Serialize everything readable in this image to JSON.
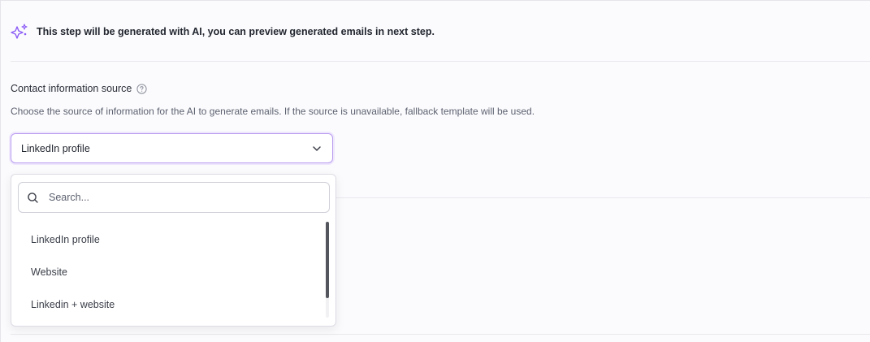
{
  "banner": {
    "icon": "sparkle-icon",
    "text": "This step will be generated with AI, you can preview generated emails in next step."
  },
  "contact_source": {
    "label": "Contact information source",
    "help_icon": "help-circle-icon",
    "description": "Choose the source of information for the AI to generate emails. If the source is unavailable, fallback template will be used.",
    "selected": "LinkedIn profile",
    "dropdown": {
      "search_placeholder": "Search...",
      "search_value": "",
      "options": [
        {
          "label": "LinkedIn profile"
        },
        {
          "label": "Website"
        },
        {
          "label": "Linkedin + website"
        }
      ]
    }
  },
  "colors": {
    "accent": "#8b5cf6",
    "select_border": "#b99cf0"
  }
}
